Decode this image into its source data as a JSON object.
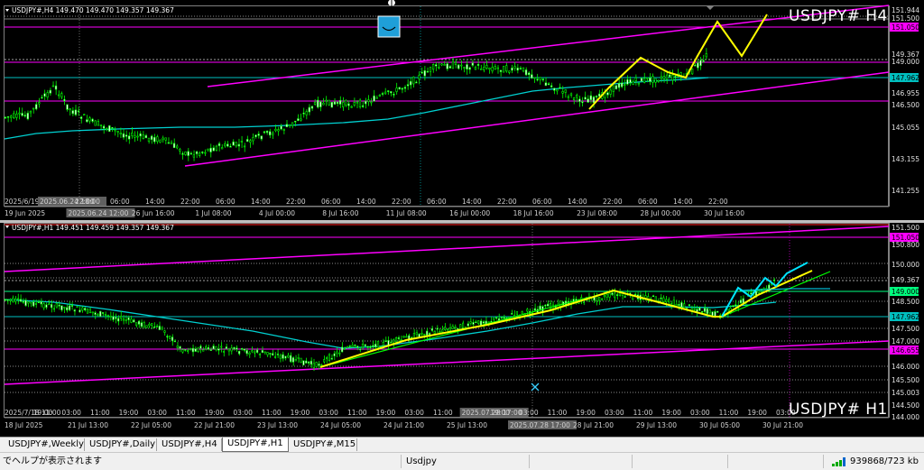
{
  "chart_h4": {
    "info": "USDJPY#,H4  149.470 149.470 149.357 149.367",
    "watermark": "USDJPY#  H4",
    "price_labels": [
      {
        "text": "151.944",
        "color": "#c0c0c0",
        "key": "a"
      },
      {
        "text": "151.500",
        "color": "#c0c0c0",
        "key": "b"
      },
      {
        "text": "151.050",
        "color": "#ff00ff",
        "key": "c"
      },
      {
        "text": "149.367",
        "color": "#c0c0c0",
        "key": "d"
      },
      {
        "text": "149.000",
        "color": "#c0c0c0",
        "key": "e"
      },
      {
        "text": "147.962",
        "color": "#00bfbf",
        "key": "f"
      },
      {
        "text": "146.955",
        "color": "#c0c0c0",
        "key": "g"
      },
      {
        "text": "146.500",
        "color": "#ffffff",
        "key": "h"
      },
      {
        "text": "145.055",
        "color": "#c0c0c0",
        "key": "i"
      },
      {
        "text": "143.155",
        "color": "#c0c0c0",
        "key": "j"
      },
      {
        "text": "141.255",
        "color": "#c0c0c0",
        "key": "k"
      }
    ],
    "time_labels_top": [
      "2025/6/19 20:00",
      "2025.06.24 18:00",
      "22:00",
      "06:00",
      "14:00",
      "22:00",
      "06:00",
      "14:00",
      "22:00",
      "06:00",
      "14:00",
      "22:00",
      "06:00",
      "14:00",
      "22:00",
      "06:00",
      "14:00",
      "22:00",
      "06:00",
      "14:00",
      "22:00"
    ],
    "time_labels_bottom": [
      "19 Jun 2025",
      "2025.06.24 12:00",
      "26 Jun 16:00",
      "1 Jul 08:00",
      "4 Jul 00:00",
      "8 Jul 16:00",
      "11 Jul 08:00",
      "16 Jul 00:00",
      "18 Jul 16:00",
      "23 Jul 08:00",
      "28 Jul 00:00",
      "30 Jul 16:00"
    ]
  },
  "chart_h1": {
    "info": "USDJPY#,H1  149.451 149.459 149.357 149.367",
    "watermark": "USDJPY#  H1",
    "price_labels": [
      {
        "text": "151.500",
        "color": "#c0c0c0"
      },
      {
        "text": "151.050",
        "color": "#ff00ff"
      },
      {
        "text": "150.800",
        "color": "#c0c0c0"
      },
      {
        "text": "150.000",
        "color": "#c0c0c0"
      },
      {
        "text": "149.367",
        "color": "#c0c0c0"
      },
      {
        "text": "149.000",
        "color": "#00ff7f"
      },
      {
        "text": "148.500",
        "color": "#c0c0c0"
      },
      {
        "text": "147.962",
        "color": "#00bfbf"
      },
      {
        "text": "147.500",
        "color": "#c0c0c0"
      },
      {
        "text": "147.000",
        "color": "#c0c0c0"
      },
      {
        "text": "146.655",
        "color": "#ff00ff"
      },
      {
        "text": "146.000",
        "color": "#c0c0c0"
      },
      {
        "text": "145.500",
        "color": "#c0c0c0"
      },
      {
        "text": "145.003",
        "color": "#c0c0c0"
      },
      {
        "text": "144.500",
        "color": "#c0c0c0"
      },
      {
        "text": "144.000",
        "color": "#c0c0c0"
      }
    ],
    "time_labels_top": [
      "2025/7/18 11:00",
      "19:00",
      "03:00",
      "11:00",
      "19:00",
      "03:00",
      "11:00",
      "19:00",
      "03:00",
      "11:00",
      "19:00",
      "03:00",
      "11:00",
      "19:00",
      "03:00",
      "11:00",
      "2025.07.28 17:00",
      "19:00",
      "03:00",
      "11:00",
      "19:00",
      "03:00",
      "11:00",
      "19:00",
      "03:00",
      "11:00",
      "19:00",
      "03:00"
    ],
    "time_labels_bottom": [
      "18 Jul 2025",
      "21 Jul 13:00",
      "22 Jul 05:00",
      "22 Jul 21:00",
      "23 Jul 13:00",
      "24 Jul 05:00",
      "24 Jul 21:00",
      "25 Jul 13:00",
      "2025.07.28 17:00",
      "28 Jul 21:00",
      "29 Jul 13:00",
      "30 Jul 05:00",
      "30 Jul 21:00"
    ]
  },
  "tabs": [
    "USDJPY#,Weekly",
    "USDJPY#,Daily",
    "USDJPY#,H4",
    "USDJPY#,H1",
    "USDJPY#,M15"
  ],
  "active_tab": "USDJPY#,H1",
  "status": {
    "help_text": "でヘルプが表示されます",
    "profile": "Usdjpy",
    "traffic": "939868/723 kb"
  }
}
